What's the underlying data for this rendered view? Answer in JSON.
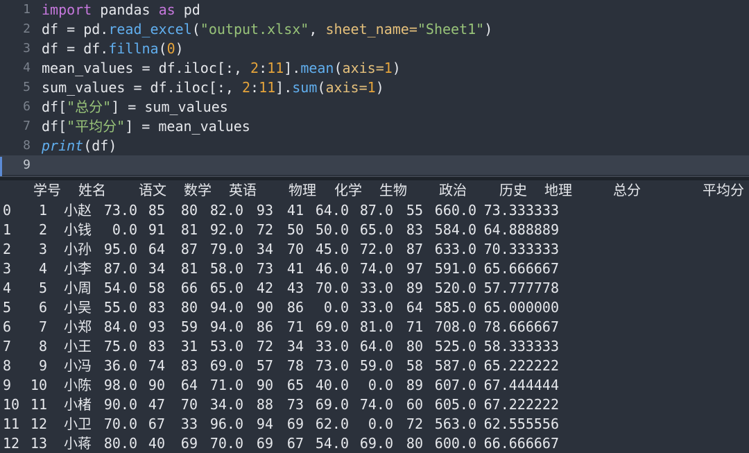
{
  "editor": {
    "active_line": 9,
    "lines": [
      {
        "num": "1",
        "tokens": [
          {
            "t": "import",
            "c": "kw"
          },
          {
            "t": " pandas ",
            "c": ""
          },
          {
            "t": "as",
            "c": "kw"
          },
          {
            "t": " pd",
            "c": ""
          }
        ]
      },
      {
        "num": "2",
        "tokens": [
          {
            "t": "df = pd.",
            "c": ""
          },
          {
            "t": "read_excel",
            "c": "fn"
          },
          {
            "t": "(",
            "c": ""
          },
          {
            "t": "\"output.xlsx\"",
            "c": "st"
          },
          {
            "t": ", ",
            "c": ""
          },
          {
            "t": "sheet_name=",
            "c": "par"
          },
          {
            "t": "\"Sheet1\"",
            "c": "st"
          },
          {
            "t": ")",
            "c": ""
          }
        ]
      },
      {
        "num": "3",
        "tokens": [
          {
            "t": "df = df.",
            "c": ""
          },
          {
            "t": "fillna",
            "c": "fn"
          },
          {
            "t": "(",
            "c": ""
          },
          {
            "t": "0",
            "c": "num"
          },
          {
            "t": ")",
            "c": ""
          }
        ]
      },
      {
        "num": "4",
        "tokens": [
          {
            "t": "mean_values = df.iloc[:, ",
            "c": ""
          },
          {
            "t": "2",
            "c": "num"
          },
          {
            "t": ":",
            "c": ""
          },
          {
            "t": "11",
            "c": "num"
          },
          {
            "t": "].",
            "c": ""
          },
          {
            "t": "mean",
            "c": "fn"
          },
          {
            "t": "(",
            "c": ""
          },
          {
            "t": "axis=",
            "c": "par"
          },
          {
            "t": "1",
            "c": "num"
          },
          {
            "t": ")",
            "c": ""
          }
        ]
      },
      {
        "num": "5",
        "tokens": [
          {
            "t": "sum_values = df.iloc[:, ",
            "c": ""
          },
          {
            "t": "2",
            "c": "num"
          },
          {
            "t": ":",
            "c": ""
          },
          {
            "t": "11",
            "c": "num"
          },
          {
            "t": "].",
            "c": ""
          },
          {
            "t": "sum",
            "c": "fn"
          },
          {
            "t": "(",
            "c": ""
          },
          {
            "t": "axis=",
            "c": "par"
          },
          {
            "t": "1",
            "c": "num"
          },
          {
            "t": ")",
            "c": ""
          }
        ]
      },
      {
        "num": "6",
        "tokens": [
          {
            "t": "df[",
            "c": ""
          },
          {
            "t": "\"总分\"",
            "c": "st"
          },
          {
            "t": "] = sum_values",
            "c": ""
          }
        ]
      },
      {
        "num": "7",
        "tokens": [
          {
            "t": "df[",
            "c": ""
          },
          {
            "t": "\"平均分\"",
            "c": "st"
          },
          {
            "t": "] = mean_values",
            "c": ""
          }
        ]
      },
      {
        "num": "8",
        "tokens": [
          {
            "t": "print",
            "c": "it"
          },
          {
            "t": "(df)",
            "c": ""
          }
        ]
      },
      {
        "num": "9",
        "tokens": []
      }
    ]
  },
  "output": {
    "headers": [
      "学号",
      "姓名",
      "语文",
      "数学",
      "英语",
      "物理",
      "化学",
      "生物",
      "政治",
      "历史",
      "地理",
      "总分",
      "平均分"
    ],
    "rows": [
      [
        "0",
        "1",
        "小赵",
        "73.0",
        "85",
        "80",
        "82.0",
        "93",
        "41",
        "64.0",
        "87.0",
        "55",
        "660.0",
        "73.333333"
      ],
      [
        "1",
        "2",
        "小钱",
        "0.0",
        "91",
        "81",
        "92.0",
        "72",
        "50",
        "50.0",
        "65.0",
        "83",
        "584.0",
        "64.888889"
      ],
      [
        "2",
        "3",
        "小孙",
        "95.0",
        "64",
        "87",
        "79.0",
        "34",
        "70",
        "45.0",
        "72.0",
        "87",
        "633.0",
        "70.333333"
      ],
      [
        "3",
        "4",
        "小李",
        "87.0",
        "34",
        "81",
        "58.0",
        "73",
        "41",
        "46.0",
        "74.0",
        "97",
        "591.0",
        "65.666667"
      ],
      [
        "4",
        "5",
        "小周",
        "54.0",
        "58",
        "66",
        "65.0",
        "42",
        "43",
        "70.0",
        "33.0",
        "89",
        "520.0",
        "57.777778"
      ],
      [
        "5",
        "6",
        "小吴",
        "55.0",
        "83",
        "80",
        "94.0",
        "90",
        "86",
        "0.0",
        "33.0",
        "64",
        "585.0",
        "65.000000"
      ],
      [
        "6",
        "7",
        "小郑",
        "84.0",
        "93",
        "59",
        "94.0",
        "86",
        "71",
        "69.0",
        "81.0",
        "71",
        "708.0",
        "78.666667"
      ],
      [
        "7",
        "8",
        "小王",
        "75.0",
        "83",
        "31",
        "53.0",
        "72",
        "34",
        "33.0",
        "64.0",
        "80",
        "525.0",
        "58.333333"
      ],
      [
        "8",
        "9",
        "小冯",
        "36.0",
        "74",
        "83",
        "69.0",
        "57",
        "78",
        "73.0",
        "59.0",
        "58",
        "587.0",
        "65.222222"
      ],
      [
        "9",
        "10",
        "小陈",
        "98.0",
        "90",
        "64",
        "71.0",
        "90",
        "65",
        "40.0",
        "0.0",
        "89",
        "607.0",
        "67.444444"
      ],
      [
        "10",
        "11",
        "小楮",
        "90.0",
        "47",
        "70",
        "34.0",
        "88",
        "73",
        "69.0",
        "74.0",
        "60",
        "605.0",
        "67.222222"
      ],
      [
        "11",
        "12",
        "小卫",
        "70.0",
        "67",
        "33",
        "96.0",
        "94",
        "69",
        "62.0",
        "0.0",
        "72",
        "563.0",
        "62.555556"
      ],
      [
        "12",
        "13",
        "小蒋",
        "80.0",
        "40",
        "69",
        "70.0",
        "69",
        "67",
        "54.0",
        "69.0",
        "80",
        "600.0",
        "66.666667"
      ]
    ]
  }
}
